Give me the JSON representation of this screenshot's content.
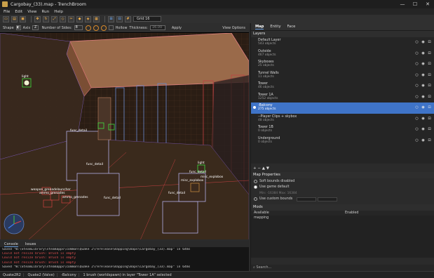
{
  "window": {
    "title": "Cargobay_(33).map - TrenchBroom",
    "controls": [
      "—",
      "☐",
      "✕"
    ]
  },
  "menu": [
    "File",
    "Edit",
    "View",
    "Run",
    "Help"
  ],
  "toolbar": {
    "grid_label": "Grid 16"
  },
  "shape_toolbar": {
    "shape_label": "Shape",
    "axis_label": "Axis",
    "axis_value": "Z",
    "sides_label": "Number of Sides:",
    "sides_value": "8",
    "hollow_label": "Hollow",
    "thickness_label": "Thickness:",
    "thickness_value": "16.00",
    "apply_label": "Apply",
    "view_options_label": "View Options"
  },
  "viewport": {
    "labels": [
      "light",
      "func_detail",
      "func_detail",
      "func_detail",
      "light",
      "misc_explobox",
      "func_detail",
      "weapon_grenadelauncher",
      "ammo_grenades",
      "ammo_grenades",
      "func_detail",
      "misc_explobox"
    ]
  },
  "console": {
    "tabs": [
      "Console",
      "Issues"
    ],
    "lines": [
      {
        "type": "ok",
        "text": "Saved \"W:\\SteamLibrary\\steamapps\\common\\Quake 2\\rerelease\\mapping\\maps\\Cargobay_(33).map\" in 64ms"
      },
      {
        "type": "err",
        "text": "Could not resize brush: Brush is empty"
      },
      {
        "type": "err",
        "text": "Could not resize brush: Brush is empty"
      },
      {
        "type": "err",
        "text": "Could not resize brush: Brush is empty"
      },
      {
        "type": "ok",
        "text": "Saved \"W:\\SteamLibrary\\steamapps\\common\\Quake 2\\rerelease\\mapping\\maps\\Cargobay_(33).map\" in 64ms"
      }
    ]
  },
  "status_bar": {
    "items": [
      "Quake2R2",
      "Quake2 (Valve)",
      "-Balcony",
      "1 brush (worldspawn) in layer \"Tower 1A\" selected"
    ]
  },
  "right_panel": {
    "tabs": [
      "Map",
      "Entity",
      "Face"
    ],
    "layers_title": "Layers",
    "layers": [
      {
        "name": "Default Layer",
        "count": "543 objects",
        "selected": false
      },
      {
        "name": "Outside",
        "count": "467 objects",
        "selected": false
      },
      {
        "name": "Skyboxes",
        "count": "25 objects",
        "selected": false
      },
      {
        "name": "Tunnel Walls",
        "count": "11 objects",
        "selected": false
      },
      {
        "name": "Tower",
        "count": "46 objects",
        "selected": false
      },
      {
        "name": "Tower 1A",
        "count": "1252 objects",
        "selected": false
      },
      {
        "name": "-Balcony",
        "count": "275 objects",
        "selected": true
      },
      {
        "name": "--Player Clips + skybox",
        "count": "48 objects",
        "selected": false
      },
      {
        "name": "Tower 1B",
        "count": "0 objects",
        "selected": false
      },
      {
        "name": "Underground",
        "count": "0 objects",
        "selected": false
      }
    ],
    "layer_toolbar": "+ − ▲ ▼",
    "map_properties_title": "Map Properties",
    "soft_bounds_label": "Soft bounds disabled",
    "use_game_default_label": "Use game default",
    "bounds_hint": "Min: -16384  Max: 16384",
    "use_custom_label": "Use custom bounds",
    "mods_title": "Mods",
    "mods_header_available": "Available",
    "mods_header_enabled": "Enabled",
    "mods_available": [
      "mapping"
    ],
    "search_placeholder": "Search..."
  }
}
